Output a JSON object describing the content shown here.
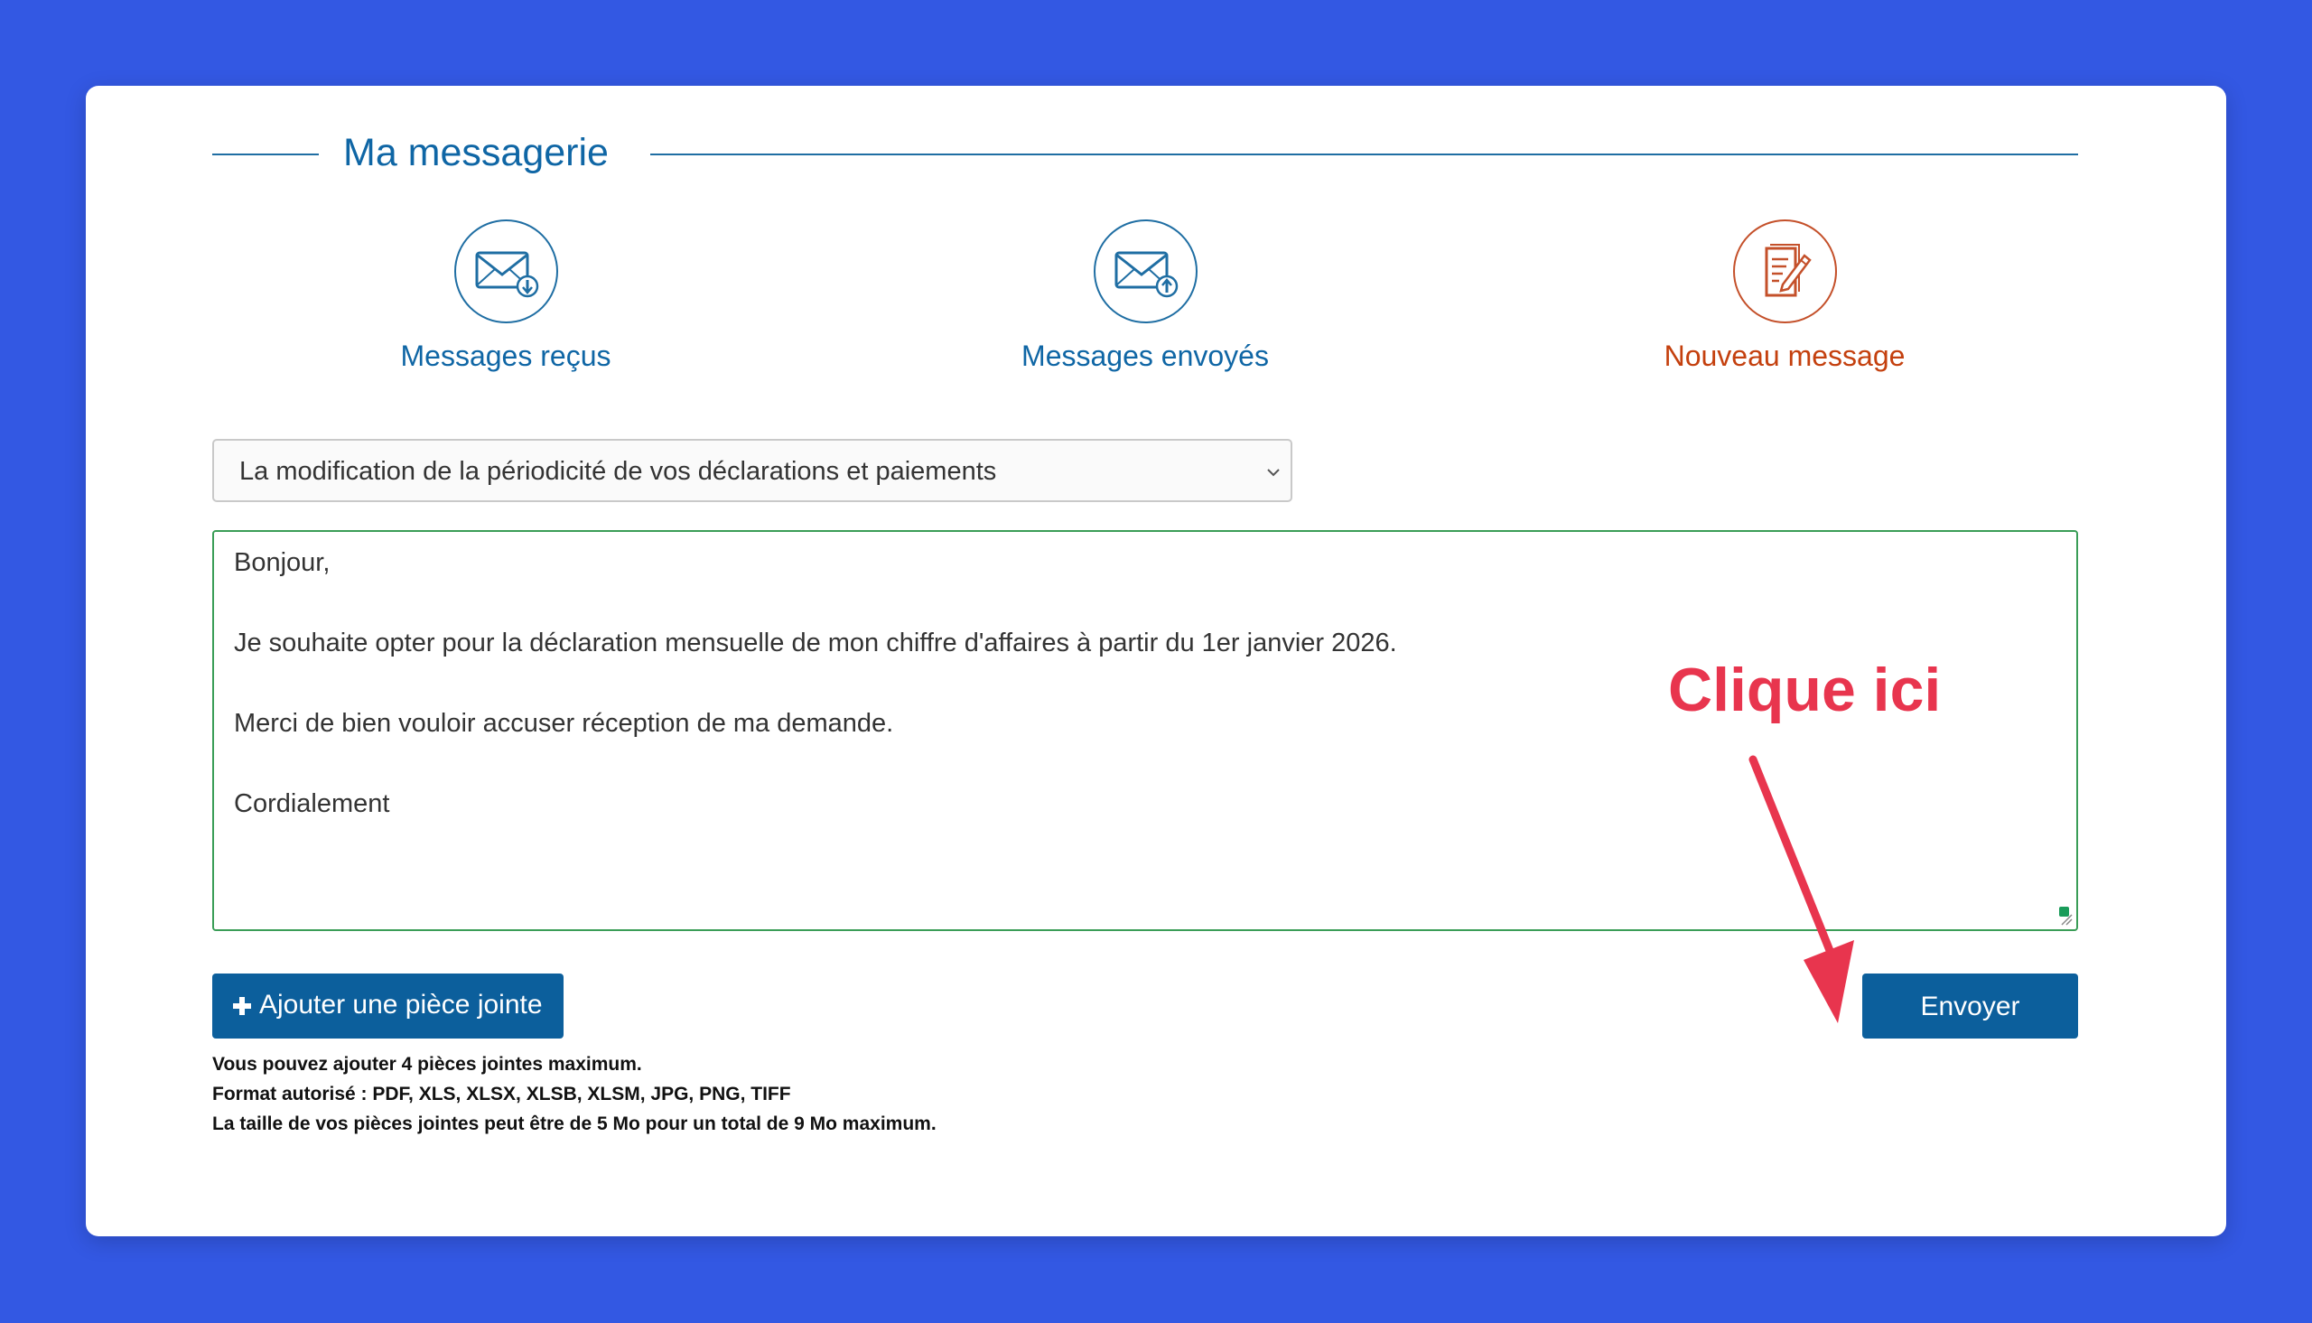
{
  "page": {
    "title": "Ma messagerie"
  },
  "nav": {
    "items": [
      {
        "label": "Messages reçus",
        "icon": "envelope-download-icon"
      },
      {
        "label": "Messages envoyés",
        "icon": "envelope-upload-icon"
      },
      {
        "label": "Nouveau message",
        "icon": "edit-document-icon"
      }
    ],
    "active_index": 2
  },
  "form": {
    "subject_select": {
      "selected": "La modification de la périodicité de vos déclarations et paiements"
    },
    "message": {
      "lines": [
        "Bonjour,",
        "Je souhaite opter pour la déclaration mensuelle de mon chiffre d'affaires à partir du 1er janvier 2026.",
        "Merci de bien vouloir accuser réception de ma demande.",
        "Cordialement"
      ]
    },
    "attach_label": "Ajouter une pièce jointe",
    "send_label": "Envoyer",
    "info_lines": [
      "Vous pouvez ajouter 4 pièces jointes maximum.",
      "Format autorisé : PDF, XLS, XLSX, XLSB, XLSM, JPG, PNG, TIFF",
      "La taille de vos pièces jointes peut être de 5 Mo pour un total de 9 Mo maximum."
    ]
  },
  "annotation": {
    "text": "Clique ici"
  },
  "colors": {
    "background": "#3358e3",
    "primary": "#0f66a5",
    "button": "#0c5f9c",
    "active": "#c4400e",
    "textarea_border": "#3a9d57",
    "annotation": "#e8354e"
  }
}
